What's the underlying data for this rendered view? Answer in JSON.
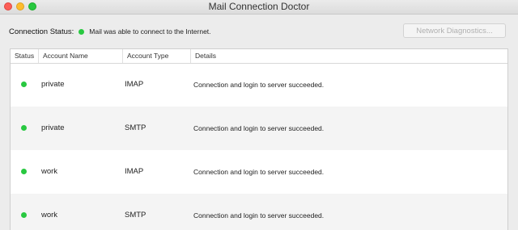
{
  "window": {
    "title": "Mail Connection Doctor"
  },
  "connection": {
    "label": "Connection Status:",
    "status_color": "#28c840",
    "message": "Mail was able to connect to the Internet."
  },
  "toolbar": {
    "network_diagnostics_label": "Network Diagnostics..."
  },
  "table": {
    "headers": [
      "Status",
      "Account Name",
      "Account Type",
      "Details"
    ],
    "rows": [
      {
        "status_color": "#28c840",
        "name": "private",
        "type": "IMAP",
        "details": "Connection and login to server succeeded."
      },
      {
        "status_color": "#28c840",
        "name": "private",
        "type": "SMTP",
        "details": "Connection and login to server succeeded."
      },
      {
        "status_color": "#28c840",
        "name": "work",
        "type": "IMAP",
        "details": "Connection and login to server succeeded."
      },
      {
        "status_color": "#28c840",
        "name": "work",
        "type": "SMTP",
        "details": "Connection and login to server succeeded."
      }
    ]
  }
}
